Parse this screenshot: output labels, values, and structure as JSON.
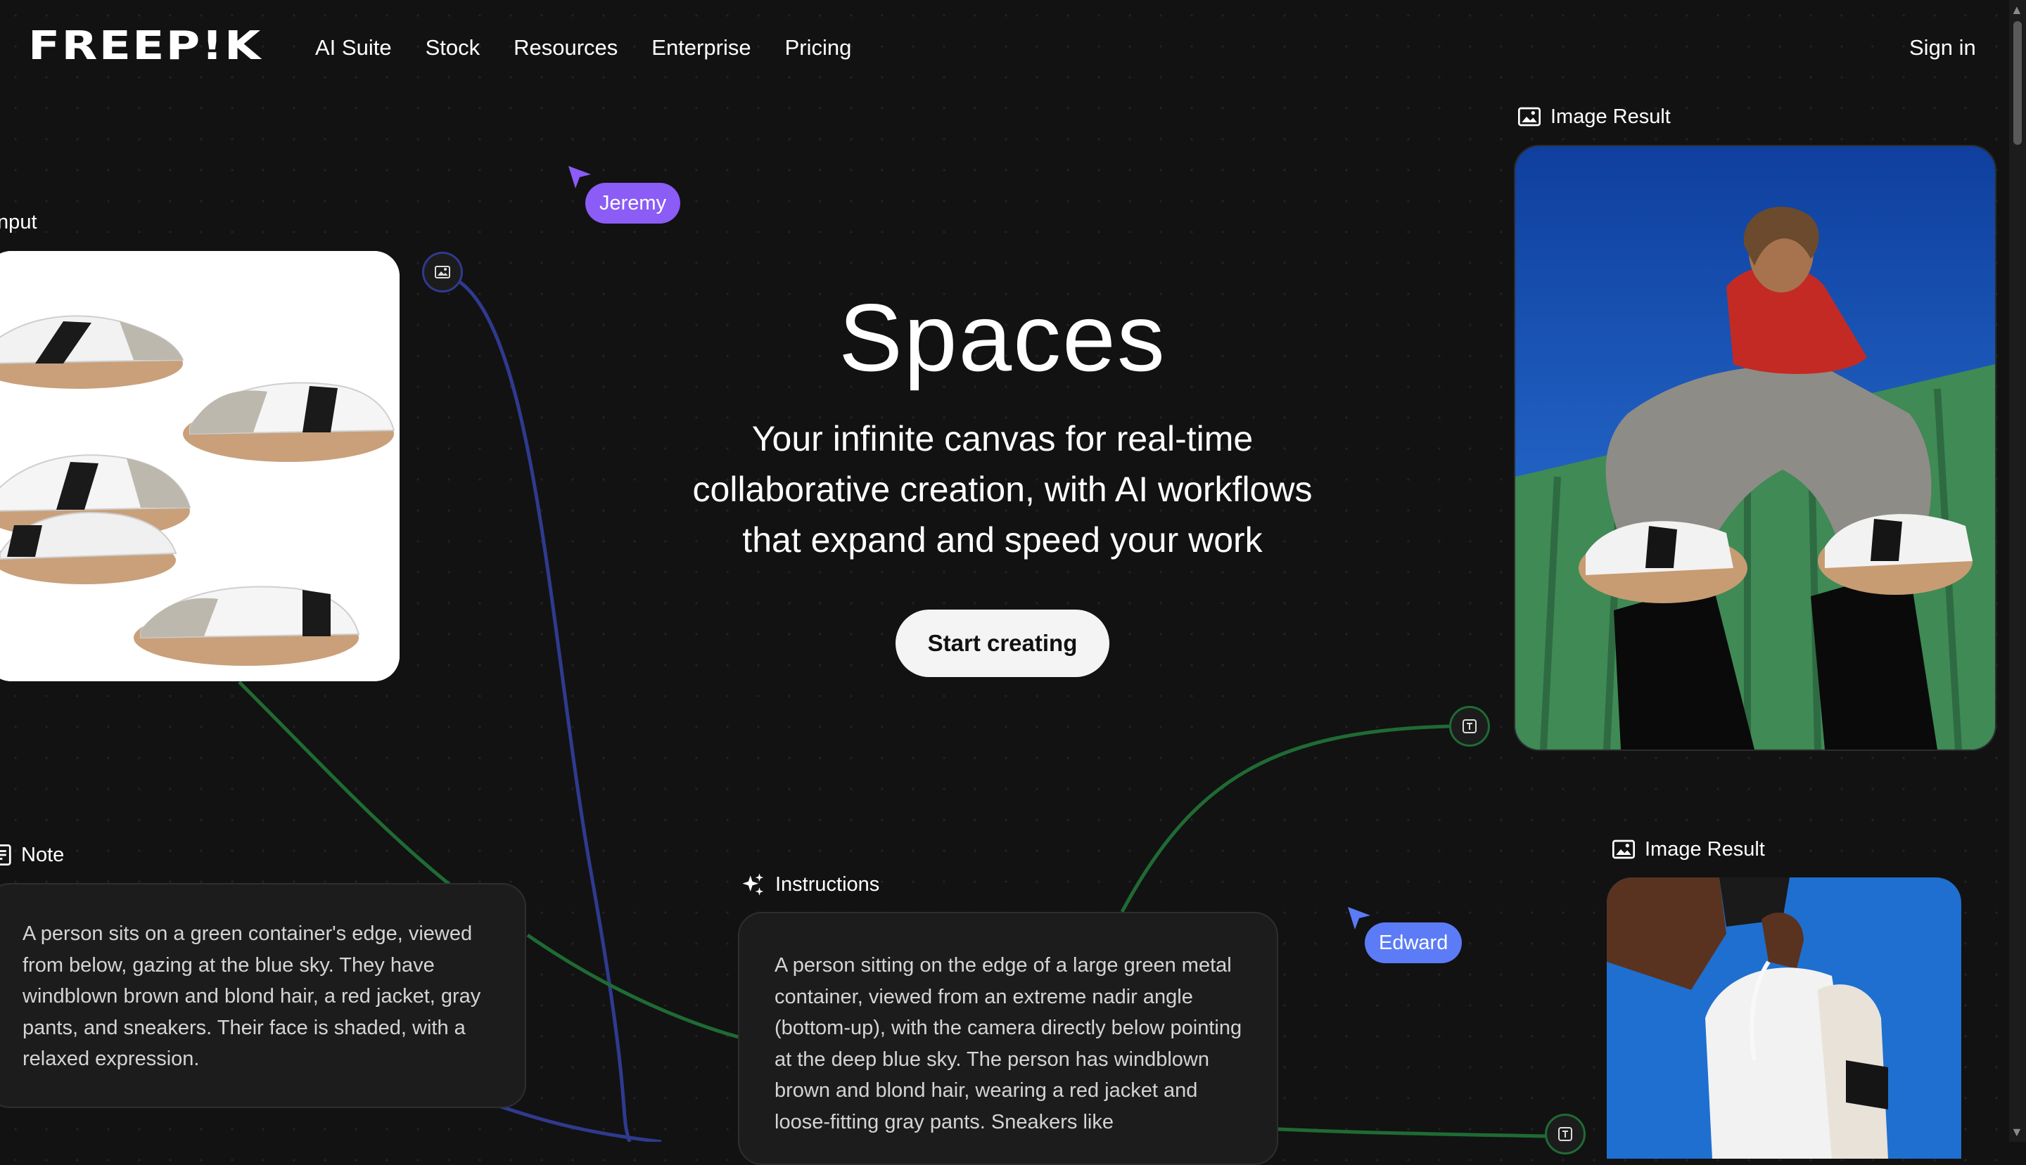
{
  "header": {
    "logo": "FREEP!K",
    "nav": [
      "AI Suite",
      "Stock",
      "Resources",
      "Enterprise",
      "Pricing"
    ],
    "sign_in": "Sign in"
  },
  "hero": {
    "title": "Spaces",
    "subtitle_lines": [
      "Your infinite canvas for real-time",
      "collaborative creation, with AI workflows",
      "that expand and speed your work"
    ],
    "cta": "Start creating"
  },
  "nodes": {
    "input_label": "Input",
    "note_label": "Note",
    "note_text": "A person sits on a green container's edge, viewed from below, gazing at the blue sky. They have windblown brown and blond hair, a red jacket, gray pants, and sneakers. Their face is shaded, with a relaxed expression.",
    "instructions_label": "Instructions",
    "instructions_text": "A person sitting on the edge of a large green metal container, viewed from an extreme nadir angle (bottom-up), with the camera directly below pointing at the deep blue sky. The person has windblown brown and blond hair, wearing a red jacket and loose-fitting gray pants. Sneakers like",
    "result1_label": "Image Result",
    "result2_label": "Image Result"
  },
  "cursors": [
    {
      "name": "Jeremy",
      "color": "#8b5cf6"
    },
    {
      "name": "Edward",
      "color": "#5b7cf6"
    }
  ],
  "colors": {
    "background": "#121212",
    "wire_blue": "#2e3a8c",
    "wire_green": "#1f6b34",
    "sky": "#1f5fc7",
    "container_green": "#3f8a55"
  }
}
